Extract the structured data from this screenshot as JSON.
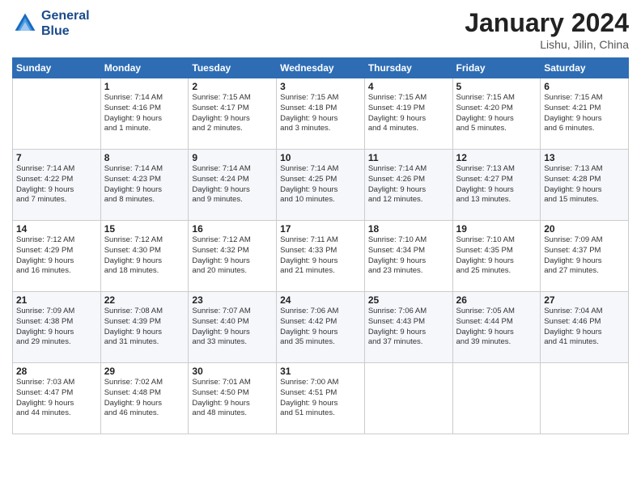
{
  "header": {
    "logo_line1": "General",
    "logo_line2": "Blue",
    "title": "January 2024",
    "subtitle": "Lishu, Jilin, China"
  },
  "columns": [
    "Sunday",
    "Monday",
    "Tuesday",
    "Wednesday",
    "Thursday",
    "Friday",
    "Saturday"
  ],
  "weeks": [
    [
      {
        "day": "",
        "info": ""
      },
      {
        "day": "1",
        "info": "Sunrise: 7:14 AM\nSunset: 4:16 PM\nDaylight: 9 hours\nand 1 minute."
      },
      {
        "day": "2",
        "info": "Sunrise: 7:15 AM\nSunset: 4:17 PM\nDaylight: 9 hours\nand 2 minutes."
      },
      {
        "day": "3",
        "info": "Sunrise: 7:15 AM\nSunset: 4:18 PM\nDaylight: 9 hours\nand 3 minutes."
      },
      {
        "day": "4",
        "info": "Sunrise: 7:15 AM\nSunset: 4:19 PM\nDaylight: 9 hours\nand 4 minutes."
      },
      {
        "day": "5",
        "info": "Sunrise: 7:15 AM\nSunset: 4:20 PM\nDaylight: 9 hours\nand 5 minutes."
      },
      {
        "day": "6",
        "info": "Sunrise: 7:15 AM\nSunset: 4:21 PM\nDaylight: 9 hours\nand 6 minutes."
      }
    ],
    [
      {
        "day": "7",
        "info": "Sunrise: 7:14 AM\nSunset: 4:22 PM\nDaylight: 9 hours\nand 7 minutes."
      },
      {
        "day": "8",
        "info": "Sunrise: 7:14 AM\nSunset: 4:23 PM\nDaylight: 9 hours\nand 8 minutes."
      },
      {
        "day": "9",
        "info": "Sunrise: 7:14 AM\nSunset: 4:24 PM\nDaylight: 9 hours\nand 9 minutes."
      },
      {
        "day": "10",
        "info": "Sunrise: 7:14 AM\nSunset: 4:25 PM\nDaylight: 9 hours\nand 10 minutes."
      },
      {
        "day": "11",
        "info": "Sunrise: 7:14 AM\nSunset: 4:26 PM\nDaylight: 9 hours\nand 12 minutes."
      },
      {
        "day": "12",
        "info": "Sunrise: 7:13 AM\nSunset: 4:27 PM\nDaylight: 9 hours\nand 13 minutes."
      },
      {
        "day": "13",
        "info": "Sunrise: 7:13 AM\nSunset: 4:28 PM\nDaylight: 9 hours\nand 15 minutes."
      }
    ],
    [
      {
        "day": "14",
        "info": "Sunrise: 7:12 AM\nSunset: 4:29 PM\nDaylight: 9 hours\nand 16 minutes."
      },
      {
        "day": "15",
        "info": "Sunrise: 7:12 AM\nSunset: 4:30 PM\nDaylight: 9 hours\nand 18 minutes."
      },
      {
        "day": "16",
        "info": "Sunrise: 7:12 AM\nSunset: 4:32 PM\nDaylight: 9 hours\nand 20 minutes."
      },
      {
        "day": "17",
        "info": "Sunrise: 7:11 AM\nSunset: 4:33 PM\nDaylight: 9 hours\nand 21 minutes."
      },
      {
        "day": "18",
        "info": "Sunrise: 7:10 AM\nSunset: 4:34 PM\nDaylight: 9 hours\nand 23 minutes."
      },
      {
        "day": "19",
        "info": "Sunrise: 7:10 AM\nSunset: 4:35 PM\nDaylight: 9 hours\nand 25 minutes."
      },
      {
        "day": "20",
        "info": "Sunrise: 7:09 AM\nSunset: 4:37 PM\nDaylight: 9 hours\nand 27 minutes."
      }
    ],
    [
      {
        "day": "21",
        "info": "Sunrise: 7:09 AM\nSunset: 4:38 PM\nDaylight: 9 hours\nand 29 minutes."
      },
      {
        "day": "22",
        "info": "Sunrise: 7:08 AM\nSunset: 4:39 PM\nDaylight: 9 hours\nand 31 minutes."
      },
      {
        "day": "23",
        "info": "Sunrise: 7:07 AM\nSunset: 4:40 PM\nDaylight: 9 hours\nand 33 minutes."
      },
      {
        "day": "24",
        "info": "Sunrise: 7:06 AM\nSunset: 4:42 PM\nDaylight: 9 hours\nand 35 minutes."
      },
      {
        "day": "25",
        "info": "Sunrise: 7:06 AM\nSunset: 4:43 PM\nDaylight: 9 hours\nand 37 minutes."
      },
      {
        "day": "26",
        "info": "Sunrise: 7:05 AM\nSunset: 4:44 PM\nDaylight: 9 hours\nand 39 minutes."
      },
      {
        "day": "27",
        "info": "Sunrise: 7:04 AM\nSunset: 4:46 PM\nDaylight: 9 hours\nand 41 minutes."
      }
    ],
    [
      {
        "day": "28",
        "info": "Sunrise: 7:03 AM\nSunset: 4:47 PM\nDaylight: 9 hours\nand 44 minutes."
      },
      {
        "day": "29",
        "info": "Sunrise: 7:02 AM\nSunset: 4:48 PM\nDaylight: 9 hours\nand 46 minutes."
      },
      {
        "day": "30",
        "info": "Sunrise: 7:01 AM\nSunset: 4:50 PM\nDaylight: 9 hours\nand 48 minutes."
      },
      {
        "day": "31",
        "info": "Sunrise: 7:00 AM\nSunset: 4:51 PM\nDaylight: 9 hours\nand 51 minutes."
      },
      {
        "day": "",
        "info": ""
      },
      {
        "day": "",
        "info": ""
      },
      {
        "day": "",
        "info": ""
      }
    ]
  ]
}
